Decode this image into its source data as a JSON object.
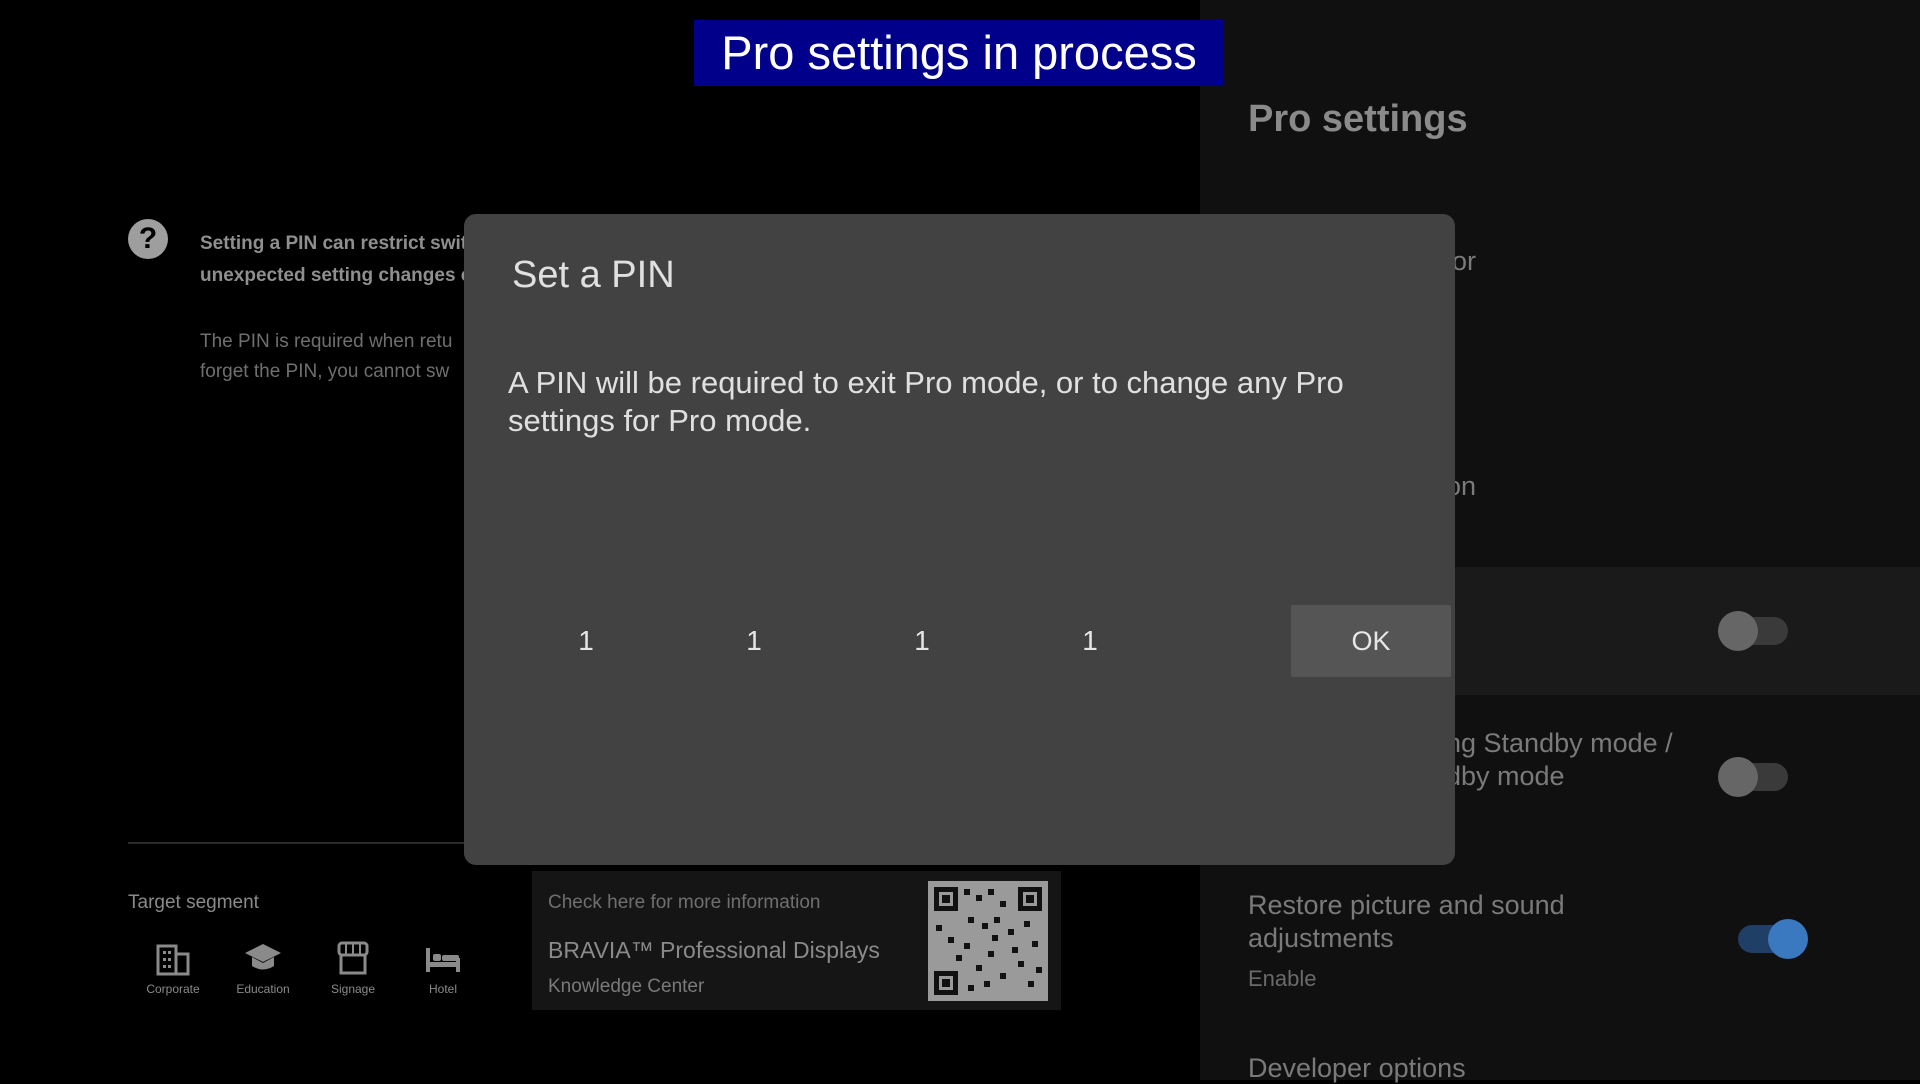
{
  "banner": {
    "text": "Pro settings in process"
  },
  "left": {
    "help_heading": "Setting a PIN can restrict swit unexpected setting changes o",
    "help_sub": "The PIN is required when retu forget the PIN, you cannot sw",
    "segment_title": "Target segment",
    "segments": [
      {
        "label": "Corporate",
        "icon": "building-icon"
      },
      {
        "label": "Education",
        "icon": "graduation-cap-icon"
      },
      {
        "label": "Signage",
        "icon": "storefront-icon"
      },
      {
        "label": "Hotel",
        "icon": "bed-icon"
      }
    ],
    "info_card": {
      "line1": "Check here for more information",
      "line2": "BRAVIA™ Professional Displays",
      "line3": "Knowledge Center"
    }
  },
  "right": {
    "title": "Pro settings",
    "item1_partial": "ior",
    "item2_partial": "on",
    "item4_line1": "ng Standby mode /",
    "item4_line2": "dby mode",
    "item5_title_line1": "Restore picture and sound",
    "item5_title_line2": "adjustments",
    "item5_sub": "Enable",
    "item6_title": "Developer options"
  },
  "dialog": {
    "title": "Set a PIN",
    "body": "A PIN will be required to exit Pro mode, or to change any Pro settings for Pro mode.",
    "pin": [
      "1",
      "1",
      "1",
      "1"
    ],
    "ok_label": "OK"
  }
}
